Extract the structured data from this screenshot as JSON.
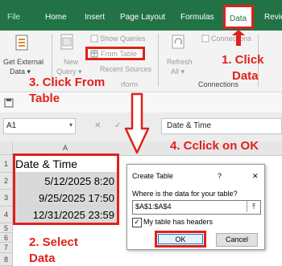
{
  "ribbon_tabs": [
    "File",
    "Home",
    "Insert",
    "Page Layout",
    "Formulas",
    "Data",
    "Revie"
  ],
  "ribbon": {
    "get_external_data_line1": "Get External",
    "get_external_data_line2": "Data ▾",
    "show_queries": "Show Queries",
    "from_table": "From Table",
    "recent_sources": "Recent Sources",
    "new_query_line1": "New",
    "new_query_line2": "Query ▾",
    "connections": "Connections",
    "properties": "Properties",
    "edit_links": "Edit Links",
    "connections_group": "Connections",
    "refresh_line1": "Refresh",
    "refresh_line2": "All ▾",
    "transform_group_partial": "rform"
  },
  "callouts": {
    "step1_line1": "1. Click",
    "step1_line2": "Data",
    "step2_line1": "2. Select",
    "step2_line2": "Data",
    "step3_line1": "3. Click From",
    "step3_line2": "Table",
    "step4": "4. Cclick on OK"
  },
  "formula_bar": {
    "name_box": "A1",
    "formula_text": "Date & Time",
    "cancel_icon": "✕",
    "enter_icon": "✓"
  },
  "sheet": {
    "column_header": "A",
    "rows": [
      {
        "num": "1",
        "value": "Date & Time"
      },
      {
        "num": "2",
        "value": "5/12/2025 8:20"
      },
      {
        "num": "3",
        "value": "9/25/2025 17:50"
      },
      {
        "num": "4",
        "value": "12/31/2025 23:59"
      },
      {
        "num": "5",
        "value": ""
      },
      {
        "num": "6",
        "value": ""
      },
      {
        "num": "7",
        "value": ""
      },
      {
        "num": "8",
        "value": ""
      }
    ]
  },
  "dialog": {
    "title": "Create Table",
    "help": "?",
    "close": "✕",
    "question": "Where is the data for your table?",
    "range": "$A$1:$A$4",
    "checkbox_label": "My table has headers",
    "checkbox_checked": true,
    "ok": "OK",
    "cancel": "Cancel"
  },
  "colors": {
    "excel_green": "#217346",
    "highlight_red": "#e0211a",
    "dialog_ok_blue": "#0078d7"
  }
}
